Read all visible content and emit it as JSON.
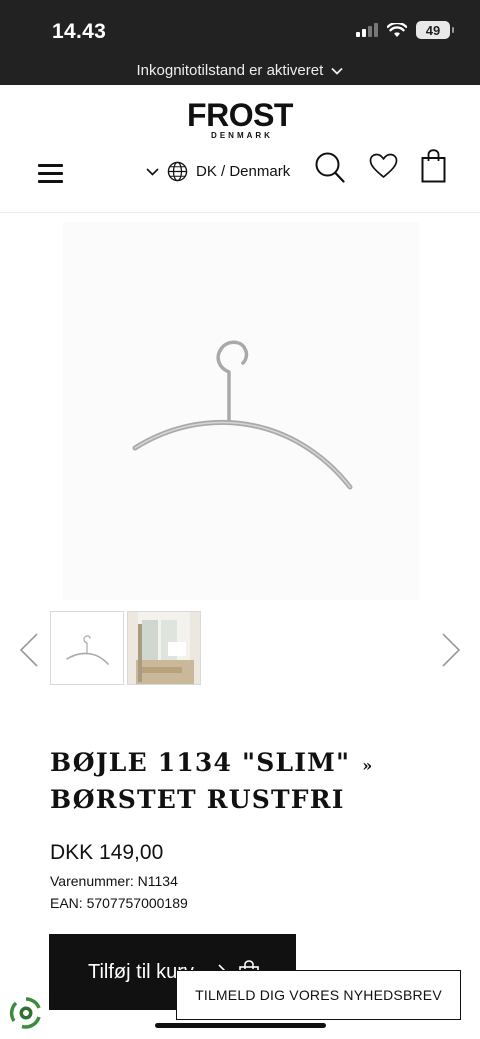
{
  "status_bar": {
    "time": "14.43",
    "battery": "49",
    "icons": [
      "signal-icon",
      "wifi-icon",
      "battery-icon"
    ]
  },
  "browser": {
    "incognito_text": "Inkognitotilstand er aktiveret"
  },
  "header": {
    "logo_main": "FROST",
    "logo_sub": "DENMARK",
    "locale_label": "DK / Denmark",
    "icons": [
      "menu-icon",
      "chevron-down-icon",
      "globe-icon",
      "search-icon",
      "heart-icon",
      "shopping-bag-icon"
    ]
  },
  "gallery": {
    "thumbnail_count": 2,
    "selected_index": 0,
    "icons": [
      "chevron-left-icon",
      "chevron-right-icon"
    ]
  },
  "product": {
    "title_line1": "BØJLE 1134 \"SLIM\"",
    "title_separator": "»",
    "title_line2": "BØRSTET RUSTFRI",
    "price": "DKK 149,00",
    "sku": "Varenummer: N1134",
    "ean": "EAN: 5707757000189"
  },
  "actions": {
    "add_to_cart_label": "Tilføj til kurv",
    "newsletter_label": "TILMELD DIG VORES NYHEDSBREV"
  },
  "colors": {
    "status_bar_bg": "#222222",
    "button_bg": "#111111",
    "accent_green": "#3d8b3d"
  }
}
